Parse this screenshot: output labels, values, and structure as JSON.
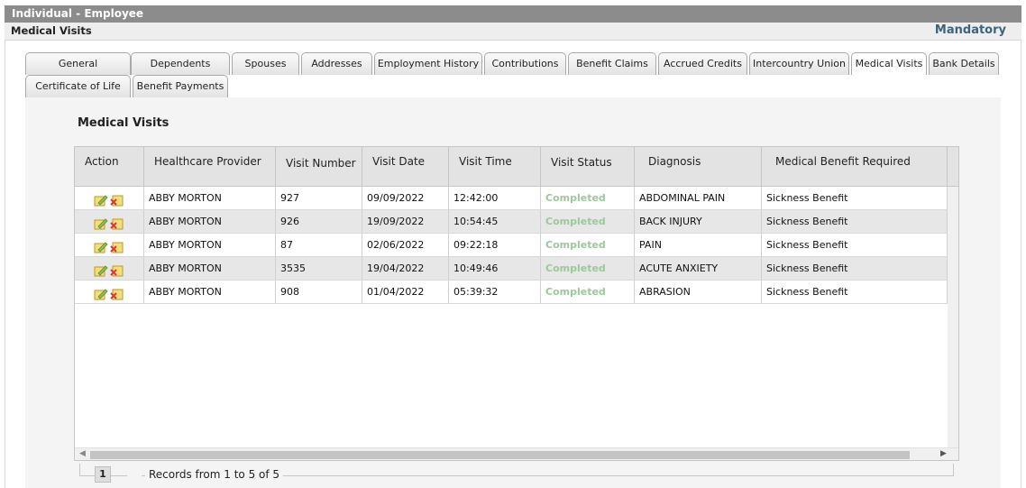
{
  "header": {
    "title": "Individual - Employee"
  },
  "subheader": {
    "title": "Medical Visits",
    "mandatory": "Mandatory"
  },
  "tabs": [
    {
      "label": "General"
    },
    {
      "label": "Dependents"
    },
    {
      "label": "Spouses"
    },
    {
      "label": "Addresses"
    },
    {
      "label": "Employment History"
    },
    {
      "label": "Contributions"
    },
    {
      "label": "Benefit Claims"
    },
    {
      "label": "Accrued Credits"
    },
    {
      "label": "Intercountry Union"
    },
    {
      "label": "Medical Visits",
      "active": true
    },
    {
      "label": "Bank Details"
    },
    {
      "label": "Certificate of Life"
    },
    {
      "label": "Benefit Payments"
    }
  ],
  "section": {
    "title": "Medical Visits"
  },
  "table": {
    "columns": [
      "Action",
      "Healthcare Provider",
      "Visit Number",
      "Visit Date",
      "Visit Time",
      "Visit Status",
      "Diagnosis",
      "Medical Benefit Required"
    ],
    "rows": [
      {
        "provider": "ABBY MORTON",
        "visit_number": "927",
        "visit_date": "09/09/2022",
        "visit_time": "12:42:00",
        "status": "Completed",
        "diagnosis": "ABDOMINAL PAIN",
        "benefit": "Sickness Benefit"
      },
      {
        "provider": "ABBY MORTON",
        "visit_number": "926",
        "visit_date": "19/09/2022",
        "visit_time": "10:54:45",
        "status": "Completed",
        "diagnosis": "BACK INJURY",
        "benefit": "Sickness Benefit"
      },
      {
        "provider": "ABBY MORTON",
        "visit_number": "87",
        "visit_date": "02/06/2022",
        "visit_time": "09:22:18",
        "status": "Completed",
        "diagnosis": "PAIN",
        "benefit": "Sickness Benefit"
      },
      {
        "provider": "ABBY MORTON",
        "visit_number": "3535",
        "visit_date": "19/04/2022",
        "visit_time": "10:49:46",
        "status": "Completed",
        "diagnosis": "ACUTE ANXIETY",
        "benefit": "Sickness Benefit"
      },
      {
        "provider": "ABBY MORTON",
        "visit_number": "908",
        "visit_date": "01/04/2022",
        "visit_time": "05:39:32",
        "status": "Completed",
        "diagnosis": "ABRASION",
        "benefit": "Sickness Benefit"
      }
    ]
  },
  "pager": {
    "current_page": "1",
    "records": "Records from 1 to 5 of 5"
  },
  "colors": {
    "title_bar": "#8c8c8c",
    "mandatory": "#3d6478",
    "status_completed": "#9cc89c"
  },
  "icons": {
    "row_actions": [
      "edit-icon",
      "delete-icon"
    ]
  }
}
